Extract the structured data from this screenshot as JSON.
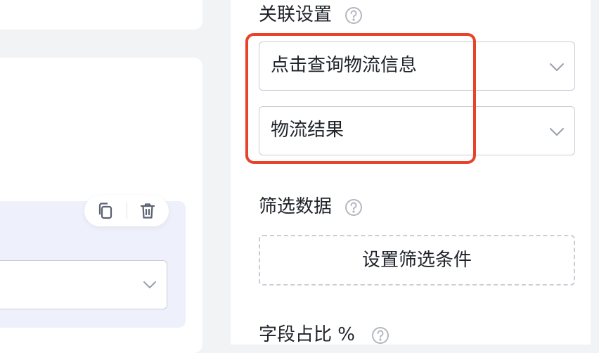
{
  "panel": {
    "relation_settings": {
      "title": "关联设置",
      "primary_select_value": "点击查询物流信息",
      "secondary_select_value": "物流结果"
    },
    "filter_data": {
      "title": "筛选数据",
      "button_label": "设置筛选条件"
    },
    "field_ratio": {
      "title": "字段占比 %"
    }
  },
  "icons": {
    "help": "help-circle-icon",
    "chevron": "chevron-down-icon",
    "copy": "copy-icon",
    "delete": "trash-icon"
  },
  "colors": {
    "highlight": "#e8432a",
    "border": "#c9cdd4",
    "block_bg": "#eef0fb"
  }
}
